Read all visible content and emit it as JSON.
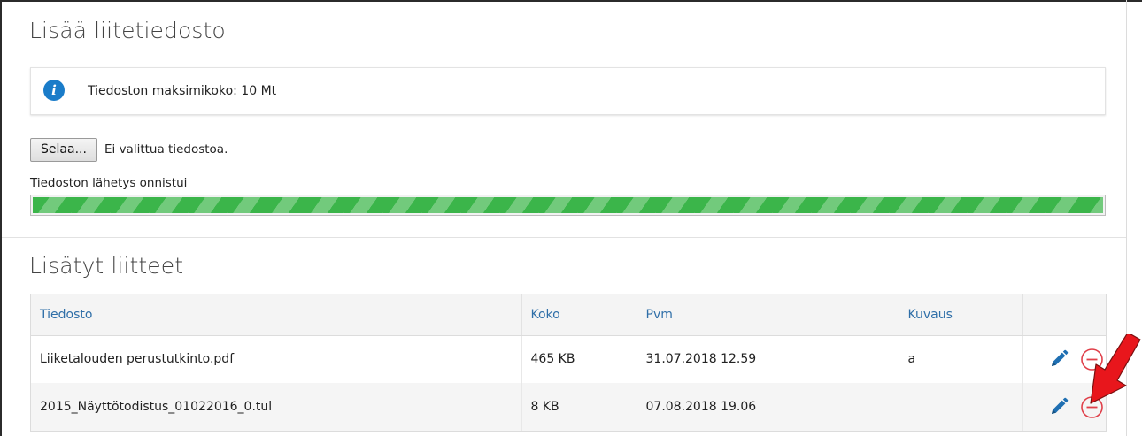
{
  "upload_section": {
    "title": "Lisää liitetiedosto",
    "info": {
      "icon": "info-icon",
      "text": "Tiedoston maksimikoko: 10 Mt"
    },
    "file_input": {
      "browse_label": "Selaa...",
      "no_file_text": "Ei valittua tiedostoa."
    },
    "status_text": "Tiedoston lähetys onnistui",
    "progress": 1.0
  },
  "attachments_section": {
    "title": "Lisätyt liitteet",
    "columns": [
      "Tiedosto",
      "Koko",
      "Pvm",
      "Kuvaus",
      ""
    ],
    "rows": [
      {
        "file": "Liiketalouden perustutkinto.pdf",
        "size": "465 KB",
        "date": "31.07.2018 12.59",
        "description": "a"
      },
      {
        "file": "2015_Näyttötodistus_01022016_0.tul",
        "size": "8 KB",
        "date": "07.08.2018 19.06",
        "description": ""
      }
    ],
    "row_actions": [
      "pencil-icon",
      "remove-circle-icon"
    ]
  },
  "colors": {
    "accent": "#2f6fa8",
    "info_icon": "#1a7cc9",
    "progress": "#3bb54a",
    "remove": "#e0404a",
    "annotation_arrow": "#e8161c"
  }
}
